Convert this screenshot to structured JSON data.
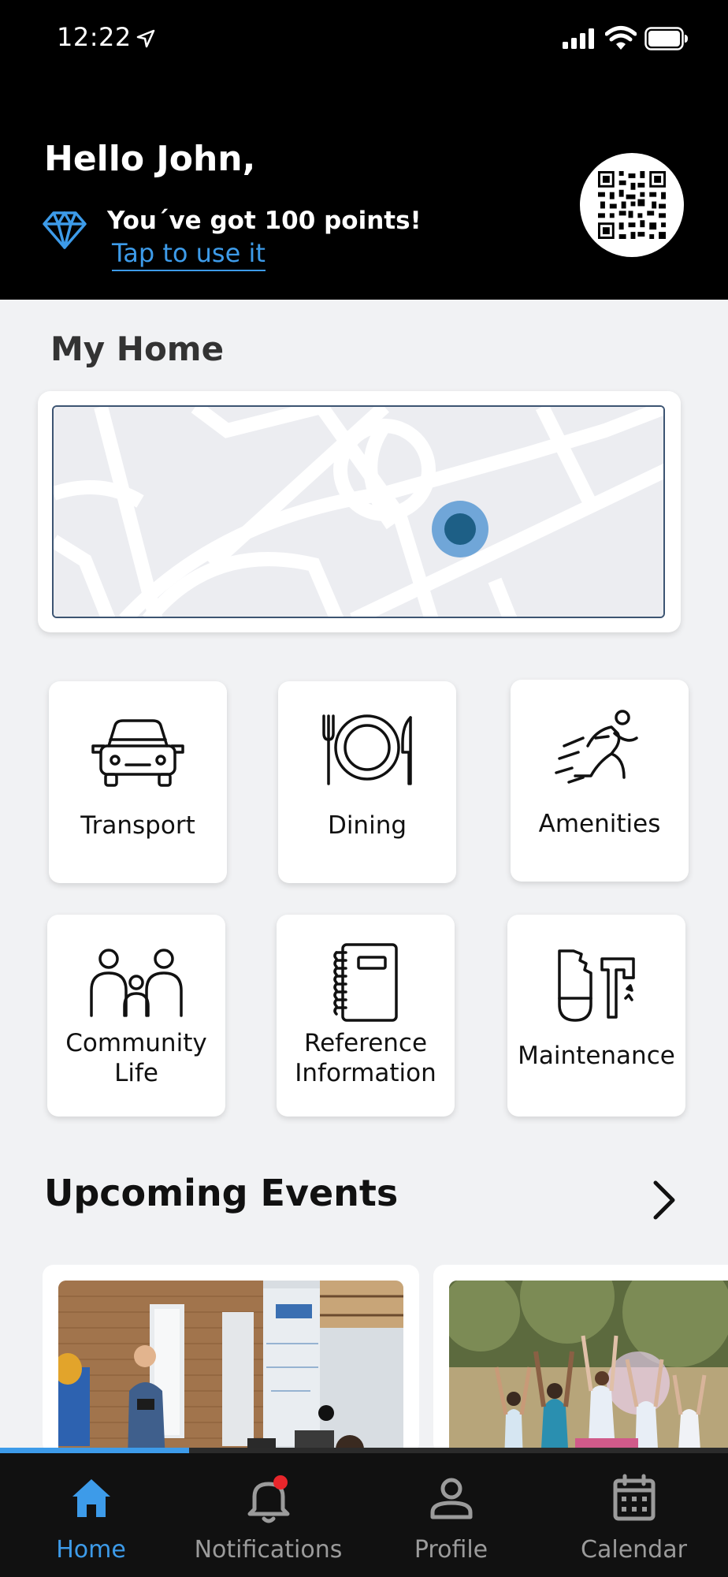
{
  "status_bar": {
    "time": "12:22"
  },
  "header": {
    "greeting": "Hello John,",
    "points_text": "You´ve got 100 points!",
    "points_link": "Tap to use it"
  },
  "my_home": {
    "title": "My Home"
  },
  "tiles": [
    {
      "label": "Transport",
      "icon": "car-icon"
    },
    {
      "label": "Dining",
      "icon": "plate-cutlery-icon"
    },
    {
      "label": "Amenities",
      "icon": "runner-icon"
    },
    {
      "label_line1": "Community",
      "label_line2": "Life",
      "icon": "people-icon"
    },
    {
      "label_line1": "Reference",
      "label_line2": "Information",
      "icon": "notebook-icon"
    },
    {
      "label": "Maintenance",
      "icon": "tools-icon"
    }
  ],
  "events": {
    "title": "Upcoming Events"
  },
  "nav": {
    "progress": 0.26,
    "items": [
      {
        "label": "Home",
        "icon": "home-icon",
        "active": true
      },
      {
        "label": "Notifications",
        "icon": "bell-icon",
        "badge": true
      },
      {
        "label": "Profile",
        "icon": "person-icon"
      },
      {
        "label": "Calendar",
        "icon": "calendar-icon"
      }
    ]
  },
  "colors": {
    "accent": "#3d9be9",
    "header_bg": "#000000",
    "page_bg": "#f1f2f4",
    "map_pin": "#1d5f86",
    "badge": "#e8262b"
  }
}
